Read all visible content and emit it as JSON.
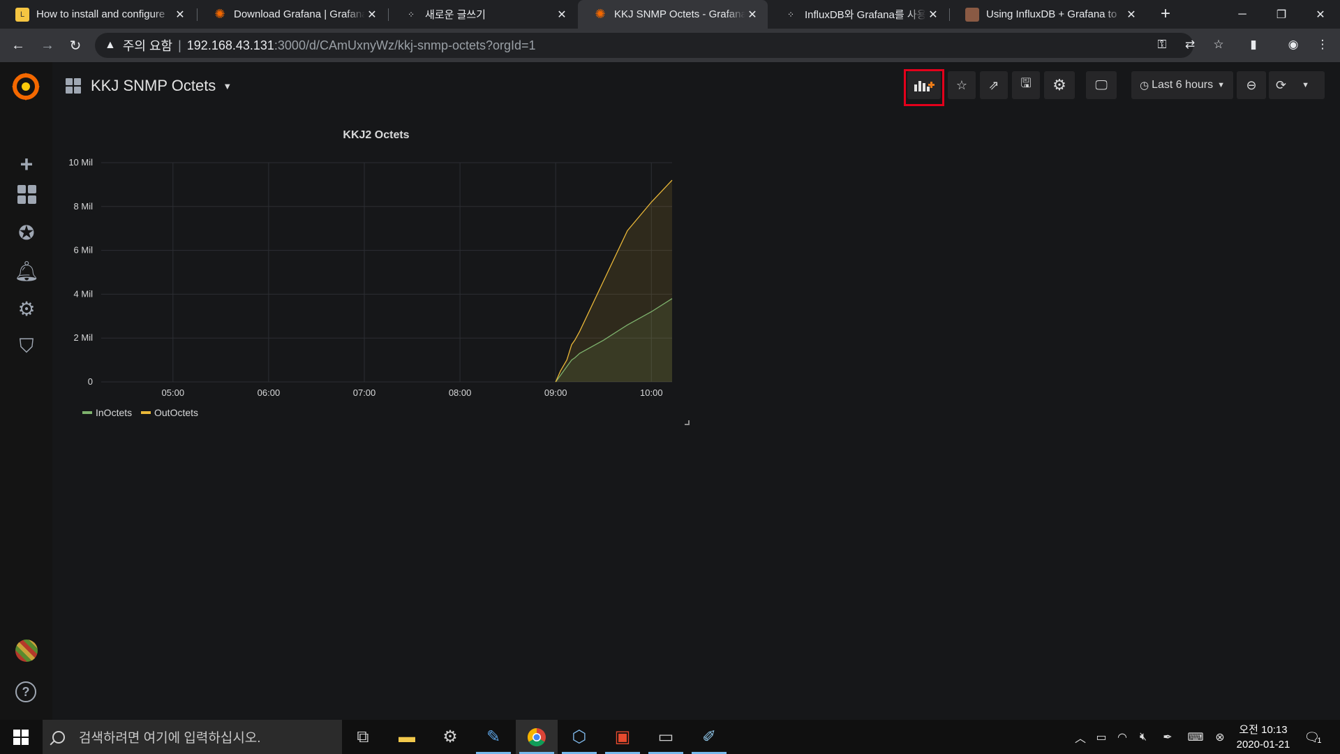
{
  "browser": {
    "tabs": [
      {
        "title": "How to install and configure",
        "favicon": "linux-icon",
        "active": false
      },
      {
        "title": "Download Grafana | Grafana",
        "favicon": "grafana-icon",
        "active": false
      },
      {
        "title": "새로운 글쓰기",
        "favicon": "tistory-icon",
        "active": false
      },
      {
        "title": "KKJ SNMP Octets - Grafana",
        "favicon": "grafana-icon",
        "active": true
      },
      {
        "title": "InfluxDB와 Grafana를 사용한",
        "favicon": "tistory-icon",
        "active": false
      },
      {
        "title": "Using InfluxDB + Grafana to",
        "favicon": "avatar-icon",
        "active": false
      }
    ],
    "address": {
      "security_label": "주의 요함",
      "host": "192.168.43.131",
      "path": ":3000/d/CAmUxnyWz/kkj-snmp-octets?orgId=1"
    }
  },
  "dashboard": {
    "title": "KKJ SNMP Octets",
    "time_range": "Last 6 hours"
  },
  "panel": {
    "title": "KKJ2 Octets"
  },
  "chart_data": {
    "type": "line",
    "title": "KKJ2 Octets",
    "x": [
      "04:30",
      "04:45",
      "05:00",
      "05:15",
      "05:30",
      "05:45",
      "06:00",
      "06:15",
      "06:30",
      "06:45",
      "07:00",
      "07:15",
      "07:30",
      "07:45",
      "08:00",
      "08:15",
      "08:30",
      "08:45",
      "09:00",
      "09:03",
      "09:07",
      "09:10",
      "09:12",
      "09:15",
      "09:30",
      "09:45",
      "10:00",
      "10:13"
    ],
    "x_ticks": [
      "05:00",
      "06:00",
      "07:00",
      "08:00",
      "09:00",
      "10:00"
    ],
    "y_ticks": [
      "0",
      "2 Mil",
      "4 Mil",
      "6 Mil",
      "8 Mil",
      "10 Mil"
    ],
    "ylim": [
      0,
      10000000
    ],
    "xlim": [
      "04:15",
      "10:13"
    ],
    "series": [
      {
        "name": "InOctets",
        "color": "#7eb26d",
        "values": [
          null,
          null,
          null,
          null,
          null,
          null,
          null,
          null,
          null,
          null,
          null,
          null,
          null,
          null,
          null,
          null,
          null,
          null,
          0,
          300000,
          700000,
          1000000,
          1100000,
          1300000,
          1900000,
          2600000,
          3200000,
          3800000
        ]
      },
      {
        "name": "OutOctets",
        "color": "#eab839",
        "values": [
          null,
          null,
          null,
          null,
          null,
          null,
          null,
          null,
          null,
          null,
          null,
          null,
          null,
          null,
          null,
          null,
          null,
          null,
          0,
          500000,
          1000000,
          1700000,
          1900000,
          2300000,
          4600000,
          6900000,
          8200000,
          9200000
        ]
      }
    ],
    "grid": true,
    "legend": "bottom-left"
  },
  "taskbar": {
    "search_placeholder": "검색하려면 여기에 입력하십시오.",
    "time": "오전 10:13",
    "date": "2020-01-21",
    "notification_count": "1"
  }
}
